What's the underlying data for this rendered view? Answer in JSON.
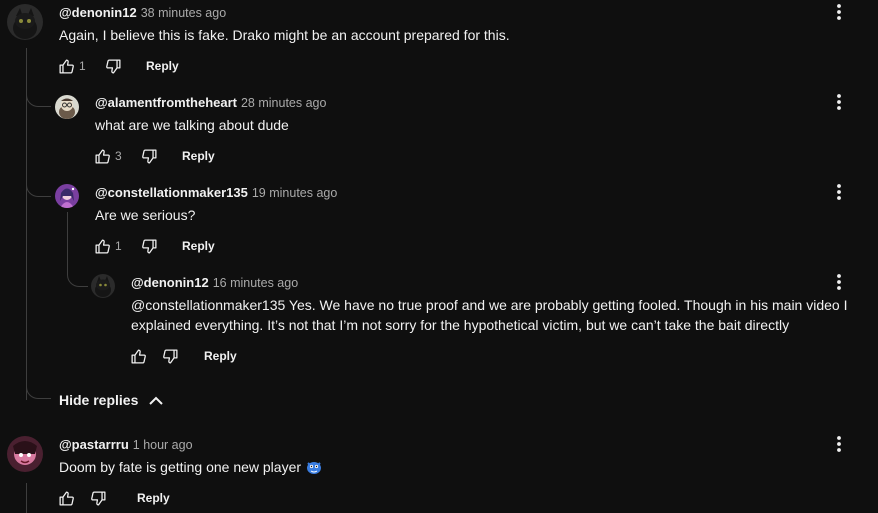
{
  "comments": [
    {
      "author": "@denonin12",
      "time": "38 minutes ago",
      "text": "Again, I believe this is fake. Drako might be an account prepared for this.",
      "likes": "1",
      "reply": "Reply"
    },
    {
      "author": "@alamentfromtheheart",
      "time": "28 minutes ago",
      "text": "what are we talking about dude",
      "likes": "3",
      "reply": "Reply"
    },
    {
      "author": "@constellationmaker135",
      "time": "19 minutes ago",
      "text": "Are we serious?",
      "likes": "1",
      "reply": "Reply"
    },
    {
      "author": "@denonin12",
      "time": "16 minutes ago",
      "text_line1": "@constellationmaker135 Yes. We have no true proof and we are probably getting fooled. Though in his main video I",
      "text_line2": "explained everything. It’s not that I’m not sorry for the hypothetical victim, but we can’t take the bait directly",
      "likes": "",
      "reply": "Reply"
    },
    {
      "author": "@pastarrru",
      "time": "1 hour ago",
      "text": "Doom by fate is getting one new player",
      "likes": "",
      "reply": "Reply"
    }
  ],
  "hide_replies": "Hide replies",
  "icons": {
    "like": "thumb-up-icon",
    "dislike": "thumb-down-icon",
    "menu": "more-vertical-icon",
    "collapse": "chevron-up-icon",
    "emoji": "blue-creature-emoji"
  },
  "colors": {
    "background": "#0f0f0f",
    "text": "#f1f1f1",
    "secondary": "#aaaaaa",
    "thread_line": "#3e3e3e"
  }
}
